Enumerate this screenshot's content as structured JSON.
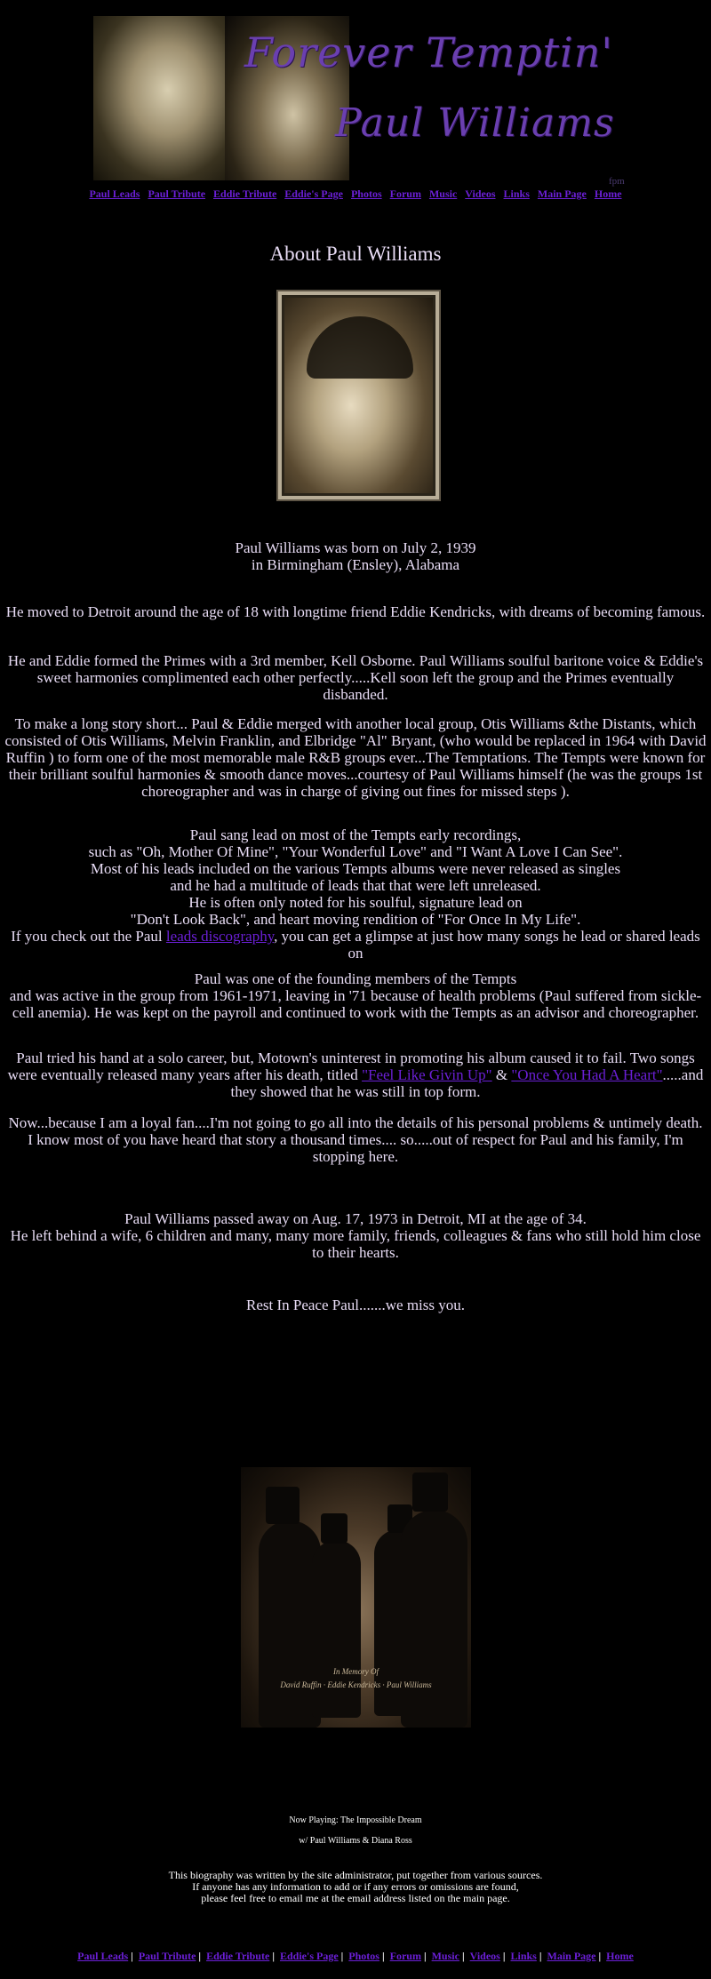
{
  "banner": {
    "title_line1": "Forever Temptin'",
    "title_line2": "Paul Williams",
    "tag": "fpm"
  },
  "nav_top": [
    "Paul Leads",
    "Paul Tribute",
    "Eddie Tribute",
    "Eddie's Page",
    "Photos",
    "Forum",
    "Music",
    "Videos",
    "Links",
    "Main Page",
    "Home"
  ],
  "nav_bottom": [
    "Paul Leads",
    "Paul Tribute",
    "Eddie Tribute",
    "Eddie's Page",
    "Photos",
    "Forum",
    "Music",
    "Videos",
    "Links",
    "Main Page",
    "Home"
  ],
  "page_title": "About Paul Williams",
  "bio": {
    "born_1": "Paul Williams was born on July 2, 1939",
    "born_2": "in Birmingham (Ensley), Alabama",
    "p1": "He moved to Detroit around the age of 18 with longtime friend Eddie Kendricks, with dreams of becoming famous.",
    "p2": "He and Eddie formed the Primes with a 3rd member, Kell Osborne. Paul Williams soulful baritone voice & Eddie's sweet harmonies complimented each other perfectly.....Kell soon left the group and the Primes eventually disbanded.",
    "p3": "To make a long story short... Paul & Eddie merged with another local group, Otis Williams &the Distants, which consisted of Otis Williams, Melvin Franklin, and Elbridge \"Al\" Bryant, (who would be replaced in 1964 with David Ruffin ) to form one of the most memorable male R&B groups ever...The Temptations. The Tempts were known for their brilliant soulful harmonies & smooth dance moves...courtesy of Paul Williams himself (he was the groups 1st choreographer and was in charge of giving out fines for missed steps ).",
    "p4_l1": "Paul sang lead on most of the Tempts early recordings,",
    "p4_l2": "such as \"Oh, Mother Of Mine\", \"Your Wonderful Love\" and \"I Want A Love I Can See\".",
    "p4_l3": "Most of his leads included on the various Tempts albums were never released as singles",
    "p4_l4": "and he had a multitude of leads that that were left unreleased.",
    "p4_l5": "He is often only noted for his soulful, signature lead on",
    "p4_l6": "\"Don't Look Back\", and heart moving rendition of \"For Once In My Life\".",
    "p4_l7_pre": "If you check out the Paul ",
    "p4_l7_link": "leads discography",
    "p4_l7_post": ", you can get a glimpse at just how many songs he lead or shared leads on",
    "p5_l1": "Paul was one of the founding members of the Tempts",
    "p5_l2": "and was active in the group from 1961-1971, leaving in '71 because of health problems (Paul suffered from sickle-cell anemia). He was kept on the payroll and continued to work with the Tempts as an advisor and choreographer.",
    "p6_pre": "Paul tried his hand at a solo career, but, Motown's uninterest in promoting his album caused it to fail. Two songs were eventually released many years after his death, titled ",
    "p6_link1": "\"Feel Like Givin Up\"",
    "p6_mid": " & ",
    "p6_link2": "\"Once You Had A Heart\"",
    "p6_post": ".....and they showed that he was still in top form.",
    "p7_l1": "Now...because I am a loyal fan....I'm not going to go all into the details of his personal problems & untimely death.",
    "p7_l2": "I know most of you have heard that story a thousand times.... so.....out of respect for Paul and his family, I'm stopping here.",
    "p8_l1": "Paul Williams passed away on Aug. 17, 1973 in Detroit, MI at the age of 34.",
    "p8_l2": "He left behind a wife, 6 children and many, many more family, friends, colleagues & fans who still hold him close to their hearts.",
    "p9": "Rest In Peace Paul.......we miss you."
  },
  "group_photo": {
    "caption1": "In Memory Of",
    "caption2": "David Ruffin · Eddie Kendricks · Paul Williams"
  },
  "now_playing": "Now Playing: The Impossible Dream",
  "now_playing_sub": "w/ Paul Williams & Diana Ross",
  "credit": {
    "l1": "This biography was written by the site administrator, put together from various sources.",
    "l2": "If anyone has any information to add or if any errors or omissions are found,",
    "l3": "please feel free to email me at the email address listed on the main page."
  }
}
